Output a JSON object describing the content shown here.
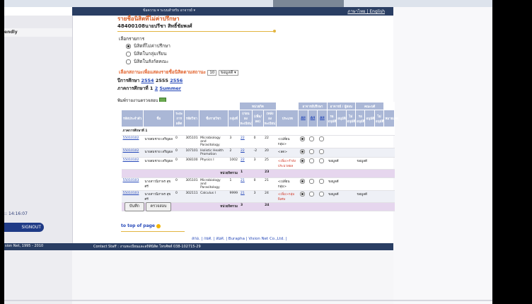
{
  "nav": {
    "menu": "ข้อความ ▾   ระบบสำหรับ อาจารย์ ▾",
    "language": "ภาษาไทย | English"
  },
  "sidebar": {
    "friendly": "endly",
    "clock": ":: 14:16:07",
    "signout": "SIGNOUT"
  },
  "page": {
    "title": "รายชื่อนิสิตที่ไม่ค่าปรึกษา",
    "student": "48400108นายปรีชา สิทธิ์ชัยพงศ์",
    "choose_label": "เลือกรายการ",
    "options": [
      {
        "label": "นิสิตที่ไม่ค่าปรึกษา",
        "selected": true
      },
      {
        "label": "นิสิตในกลุ่มเรียน",
        "selected": false
      },
      {
        "label": "นิสิตในสังกัดคณะ",
        "selected": false
      }
    ],
    "display_label": "เลือกสถานะเพื่อแสดงรายชื่อนิสิตตามสถานะ",
    "display_count": "10",
    "display_select": "ขอมูลดี ▾",
    "year_label": "ปีการศึกษา",
    "years": [
      "2554",
      "2555",
      "2556"
    ],
    "year_current": "2555",
    "term_label": "ภาคการศึกษาที่",
    "terms": [
      "1",
      "2",
      "Summer"
    ],
    "term_current": "1",
    "print_label": "พิมพ์รายงานตรวจสอบ"
  },
  "table": {
    "group_headers": {
      "credits": "หน่วยกิต",
      "advisor": "อาจารย์ปรึกษา",
      "teacher": "อาจารย์ / ผู้สอน",
      "faculty": "คณะบดี"
    },
    "headers": [
      "รหัสประจำตัว",
      "ชื่อ",
      "ระยะการผลิต",
      "รหัสวิชา",
      "ชื่อรายวิชา",
      "กลุ่มที่",
      "(ก่อน ลงทะเบียน)",
      "(เพิ่ม/ลด)",
      "(หลัง ลงทะเบียน)",
      "ประเภท",
      "All",
      "All",
      "All",
      "รอ อนุมัติ",
      "อนุมัติ",
      "ไม่ อนุมัติ",
      "รอ อนุมัติ",
      "อนุมัติ",
      "ไม่ อนุมัติ",
      "หมายเหตุ"
    ],
    "semester": "ภาคการศึกษาที่ 1",
    "rows": [
      {
        "id": "55010102",
        "name": "นายสมชาย เจริญผล",
        "prog": "0",
        "code": "305101",
        "course": "Microbiology and Parasitology",
        "group": "3",
        "before": "22",
        "change": "0",
        "after": "22",
        "type": "<เปลี่ยน กลุ่ม>",
        "adv": 0,
        "note": "",
        "fac": ""
      },
      {
        "id": "55010102",
        "name": "นายสมชาย เจริญผล",
        "prog": "0",
        "code": "107101",
        "course": "Holistic Health Promotion",
        "group": "2",
        "before": "22",
        "change": "-2",
        "after": "20",
        "type": "<ลด>",
        "adv": 0,
        "note": "",
        "fac": ""
      },
      {
        "id": "55010102",
        "name": "นายสมชาย เจริญผล",
        "prog": "0",
        "code": "308100",
        "course": "Physics I",
        "group": "1002",
        "before": "22",
        "change": "3",
        "after": "25",
        "type": "<เพิ่ม>กำลัง ประมวลผล",
        "adv": 0,
        "note": "ขอมูลดี",
        "fac": "ขอมูลดี"
      },
      {
        "id": "55010103",
        "name": "นางสาวนิภาพร สุขศรี",
        "prog": "0",
        "code": "305101",
        "course": "Microbiology and Parasitology",
        "group": "1",
        "before": "21",
        "change": "0",
        "after": "21",
        "type": "<เปลี่ยน กลุ่ม>",
        "adv": 0,
        "note": "ขอมูลดี",
        "fac": ""
      },
      {
        "id": "55010103",
        "name": "นางสาวนิภาพร สุขศรี",
        "prog": "0",
        "code": "302111",
        "course": "Calculus I",
        "group": "9999",
        "before": "21",
        "change": "3",
        "after": "24",
        "type": "<เพิ่ม>กลุ่ม พิเศษ",
        "adv": 0,
        "note": "ขอมูลดี",
        "fac": "ขอมูลดี"
      }
    ],
    "total_label": "หน่วยกิตรวม",
    "totals": [
      {
        "before": "1",
        "after": "23"
      },
      {
        "before": "3",
        "after": "24"
      }
    ]
  },
  "buttons": {
    "save": "บันทึก",
    "check": "ตรวจสอบ"
  },
  "to_top": "to top of page",
  "footer_links": "สกอ. | กยศ. | สมศ. | Burapha | Vision Net Co.,Ltd. |",
  "footer": {
    "copyright": "sion Net, 1995 - 2010",
    "contact": "Contact Staff : งานทะเบียนและสถิตินิสิต โทรศัพท์ 038-102715-29"
  },
  "colors": {
    "navbar": "#2a3e63",
    "title": "#d85a1e",
    "link": "#2447b8",
    "table_header": "#aab7d6"
  }
}
